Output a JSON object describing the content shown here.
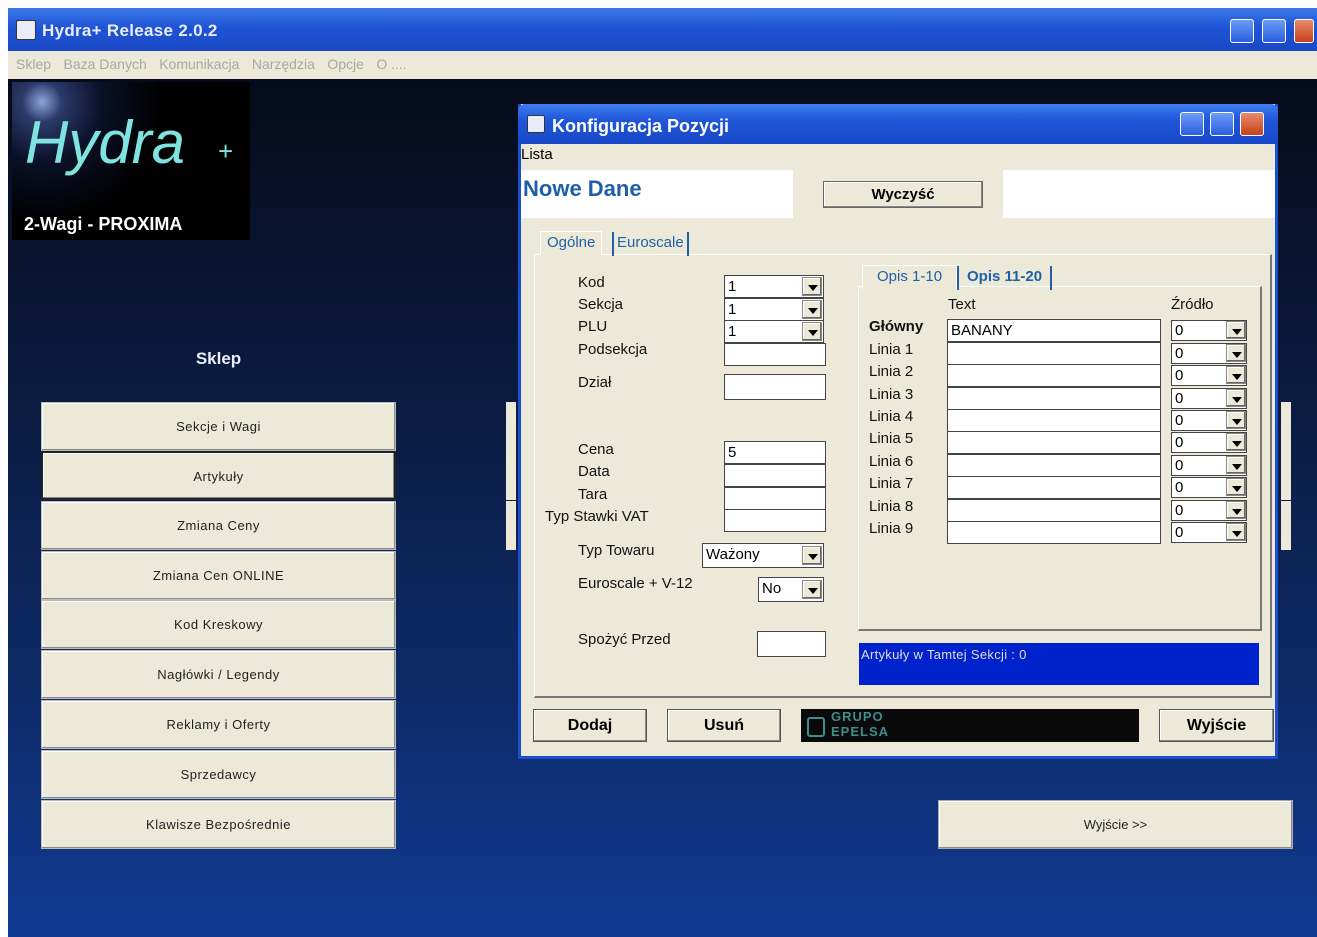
{
  "main": {
    "title": "Hydra+ Release 2.0.2",
    "menu": [
      "Sklep",
      "Baza Danych",
      "Komunikacja",
      "Narzędzia",
      "Opcje",
      "O ...."
    ],
    "logo": {
      "title": "Hydra",
      "plus": "+",
      "subtitle": "2-Wagi - PROXIMA"
    },
    "sklep_label": "Sklep",
    "nav": [
      "Sekcje i Wagi",
      "Artykuły",
      "Zmiana Ceny",
      "Zmiana Cen ONLINE",
      "Kod Kreskowy",
      "Nagłówki / Legendy",
      "Reklamy i Oferty",
      "Sprzedawcy",
      "Klawisze Bezpośrednie"
    ],
    "selected_nav": "Artykuły",
    "exit_button": "Wyjście >>"
  },
  "dialog": {
    "title": "Konfiguracja Pozycji",
    "menu": "Lista",
    "mode": "Nowe Dane",
    "clear_button": "Wyczyść",
    "tabs": [
      "Ogólne",
      "Euroscale"
    ],
    "fields": {
      "kod": {
        "label": "Kod",
        "value": "1"
      },
      "sekcja": {
        "label": "Sekcja",
        "value": "1"
      },
      "plu": {
        "label": "PLU",
        "value": "1"
      },
      "podsekcja": {
        "label": "Podsekcja",
        "value": ""
      },
      "dzial": {
        "label": "Dział",
        "value": ""
      },
      "cena": {
        "label": "Cena",
        "value": "5"
      },
      "data": {
        "label": "Data",
        "value": ""
      },
      "tara": {
        "label": "Tara",
        "value": ""
      },
      "vat": {
        "label": "Typ Stawki VAT",
        "value": ""
      },
      "typ_towaru": {
        "label": "Typ Towaru",
        "value": "Ważony"
      },
      "euroscale": {
        "label": "Euroscale + V-12",
        "value": "No"
      },
      "spozyc": {
        "label": "Spożyć Przed",
        "value": ""
      }
    },
    "opis_tabs": [
      "Opis 1-10",
      "Opis 11-20"
    ],
    "opis_headers": {
      "text": "Text",
      "source": "Źródło"
    },
    "opis_rows": [
      {
        "label": "Główny",
        "text": "BANANY",
        "source": "0"
      },
      {
        "label": "Linia 1",
        "text": "",
        "source": "0"
      },
      {
        "label": "Linia 2",
        "text": "",
        "source": "0"
      },
      {
        "label": "Linia 3",
        "text": "",
        "source": "0"
      },
      {
        "label": "Linia 4",
        "text": "",
        "source": "0"
      },
      {
        "label": "Linia 5",
        "text": "",
        "source": "0"
      },
      {
        "label": "Linia 6",
        "text": "",
        "source": "0"
      },
      {
        "label": "Linia 7",
        "text": "",
        "source": "0"
      },
      {
        "label": "Linia 8",
        "text": "",
        "source": "0"
      },
      {
        "label": "Linia 9",
        "text": "",
        "source": "0"
      }
    ],
    "status": "Artykuły w Tamtej Sekcji : 0",
    "buttons": {
      "add": "Dodaj",
      "remove": "Usuń",
      "exit": "Wyjście"
    },
    "logo": {
      "line1": "GRUPO",
      "line2": "EPELSA"
    }
  }
}
